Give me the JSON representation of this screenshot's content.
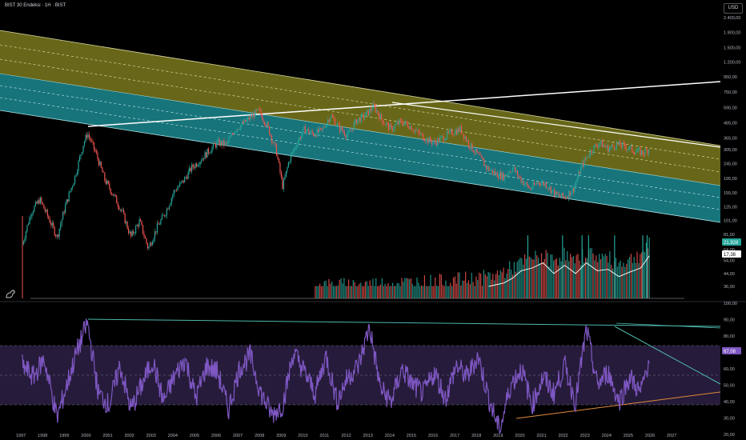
{
  "header": {
    "title": "BIST 30 Endeksi · 1H · BIST",
    "currency": "USD"
  },
  "price_axis": {
    "labels": [
      "2.400,00",
      "1.900,00",
      "1.500,00",
      "1.200,00",
      "950,00",
      "750,00",
      "590,00",
      "465,00",
      "365,00",
      "305,00",
      "245,00",
      "195,00",
      "155,00",
      "125,00",
      "101,00",
      "81,00",
      "64,00",
      "54,00",
      "44,00",
      "36,00"
    ],
    "volume_badge": "21,928",
    "volume_ma_badge": "17,38"
  },
  "rsi_axis": {
    "labels": [
      "100,00",
      "90,00",
      "80,00",
      "70,00",
      "60,00",
      "50,00",
      "40,00",
      "30,00",
      "20,00"
    ],
    "value_badge": "67,08"
  },
  "time_axis": {
    "labels": [
      "1997",
      "1998",
      "1999",
      "2000",
      "2001",
      "2002",
      "2003",
      "2004",
      "2005",
      "2006",
      "2007",
      "2008",
      "2009",
      "2010",
      "2011",
      "2012",
      "2013",
      "2014",
      "2015",
      "2016",
      "2017",
      "2018",
      "2019",
      "2020",
      "2021",
      "2022",
      "2023",
      "2024",
      "2025",
      "2026",
      "2027"
    ]
  },
  "chart_data": {
    "type": "line",
    "price_scale": "log",
    "price_series": {
      "x": [
        1997.0,
        1997.4,
        1997.8,
        1998.2,
        1998.6,
        1999.0,
        1999.4,
        1999.8,
        2000.0,
        2000.4,
        2000.8,
        2001.2,
        2001.6,
        2002.0,
        2002.4,
        2002.8,
        2003.2,
        2003.6,
        2004.0,
        2004.4,
        2004.8,
        2005.2,
        2005.6,
        2006.0,
        2006.4,
        2006.8,
        2007.2,
        2007.6,
        2007.9,
        2008.3,
        2008.7,
        2009.0,
        2009.3,
        2009.7,
        2010.0,
        2010.4,
        2010.8,
        2011.2,
        2011.6,
        2012.0,
        2012.4,
        2012.8,
        2013.2,
        2013.6,
        2014.0,
        2014.4,
        2014.8,
        2015.2,
        2015.6,
        2016.0,
        2016.4,
        2016.8,
        2017.2,
        2017.6,
        2018.0,
        2018.4,
        2018.8,
        2019.2,
        2019.6,
        2020.0,
        2020.4,
        2020.8,
        2021.2,
        2021.6,
        2022.0,
        2022.4,
        2022.8,
        2023.2,
        2023.6,
        2024.0,
        2024.4,
        2024.8,
        2025.2,
        2025.6,
        2025.9
      ],
      "y": [
        70,
        115,
        140,
        105,
        78,
        130,
        195,
        330,
        395,
        285,
        190,
        150,
        115,
        78,
        100,
        65,
        90,
        115,
        160,
        185,
        230,
        260,
        300,
        340,
        330,
        420,
        460,
        520,
        560,
        440,
        300,
        170,
        260,
        350,
        420,
        390,
        410,
        520,
        430,
        380,
        480,
        520,
        600,
        480,
        420,
        470,
        450,
        400,
        360,
        340,
        370,
        400,
        420,
        330,
        280,
        230,
        210,
        200,
        230,
        190,
        165,
        185,
        175,
        150,
        145,
        165,
        240,
        300,
        340,
        310,
        330,
        320,
        300,
        290,
        310
      ]
    },
    "volume_bars": {
      "x": [
        2010.5,
        2011,
        2011.5,
        2012,
        2012.5,
        2013,
        2013.5,
        2014,
        2014.5,
        2015,
        2015.5,
        2016,
        2016.5,
        2017,
        2017.5,
        2018,
        2018.5,
        2019,
        2019.5,
        2020,
        2020.5,
        2021,
        2021.5,
        2022,
        2022.5,
        2023,
        2023.5,
        2024,
        2024.5,
        2025,
        2025.5,
        2025.9
      ],
      "y": [
        36,
        36.5,
        36.5,
        37,
        37,
        37.5,
        37.5,
        38,
        38,
        38.5,
        38.5,
        39,
        39,
        40,
        40.5,
        41,
        42,
        44,
        48,
        52,
        56,
        58,
        54,
        60,
        52,
        62,
        58,
        56,
        52,
        55,
        60,
        70
      ]
    },
    "volume_ma": {
      "x": [
        2018.5,
        2019.2,
        2019.6,
        2020.0,
        2020.5,
        2021.0,
        2021.5,
        2022.0,
        2022.5,
        2023.0,
        2023.5,
        2024.0,
        2024.5,
        2025.0,
        2025.5,
        2025.9
      ],
      "y": [
        36,
        38,
        41,
        46,
        48,
        52,
        44,
        50,
        44,
        52,
        46,
        47,
        42,
        45,
        48,
        58
      ]
    },
    "rsi_series": {
      "x": [
        1997.0,
        1997.5,
        1998.0,
        1998.6,
        1999.0,
        1999.5,
        2000.0,
        2000.5,
        2001.0,
        2001.5,
        2002.0,
        2002.5,
        2003.0,
        2003.5,
        2004.0,
        2004.5,
        2005.0,
        2005.5,
        2006.0,
        2006.5,
        2007.0,
        2007.5,
        2008.0,
        2008.5,
        2009.0,
        2009.5,
        2010.0,
        2010.5,
        2011.0,
        2011.5,
        2012.0,
        2012.5,
        2013.0,
        2013.5,
        2014.0,
        2014.5,
        2015.0,
        2015.5,
        2016.0,
        2016.5,
        2017.0,
        2017.5,
        2018.0,
        2018.5,
        2019.0,
        2019.5,
        2020.0,
        2020.5,
        2021.0,
        2021.5,
        2022.0,
        2022.5,
        2023.0,
        2023.5,
        2024.0,
        2024.5,
        2025.0,
        2025.5,
        2025.9
      ],
      "y": [
        62,
        55,
        66,
        30,
        48,
        70,
        88,
        45,
        38,
        62,
        35,
        50,
        65,
        40,
        55,
        66,
        42,
        62,
        58,
        35,
        60,
        68,
        45,
        32,
        38,
        70,
        58,
        45,
        68,
        40,
        55,
        62,
        86,
        48,
        40,
        60,
        50,
        45,
        58,
        42,
        62,
        55,
        68,
        42,
        22,
        50,
        60,
        38,
        55,
        45,
        62,
        40,
        84,
        50,
        58,
        40,
        55,
        45,
        67
      ]
    },
    "rsi_value": 67.08,
    "rsi_levels": {
      "upper": 70,
      "middle": 50,
      "lower": 30
    },
    "rsi_ylim": [
      20,
      100
    ],
    "colors": {
      "upper_channel": "#8b8a22",
      "lower_channel": "#1f9ba3",
      "rsi_line": "#7e57c2",
      "rsi_band": "#2a1e40",
      "up_candle": "#26a69a",
      "down_candle": "#ef5350",
      "trend_white": "#ffffff",
      "rsi_trend_teal": "#4db6ac",
      "rsi_trend_orange": "#e08a3c"
    }
  }
}
